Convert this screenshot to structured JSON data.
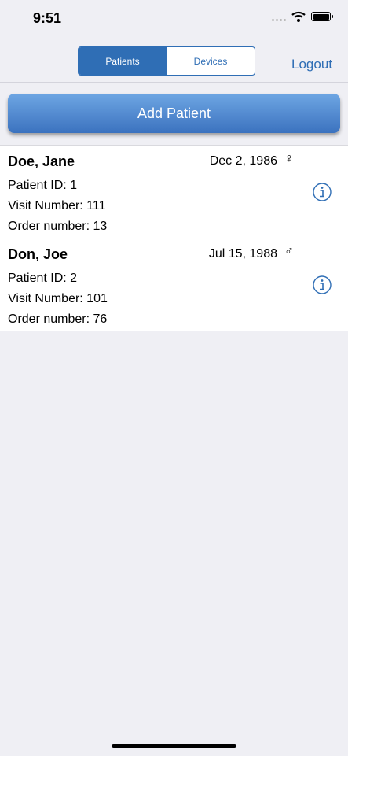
{
  "status_bar": {
    "time": "9:51"
  },
  "nav": {
    "segments": [
      "Patients",
      "Devices"
    ],
    "selected_segment": "Patients",
    "logout_label": "Logout"
  },
  "add_patient_label": "Add Patient",
  "patients": [
    {
      "name": "Doe, Jane",
      "dob": "Dec 2, 1986",
      "gender_symbol": "♀",
      "patient_id": "Patient ID: 1",
      "visit_number": "Visit Number: 111",
      "order_number": "Order number: 13"
    },
    {
      "name": "Don, Joe",
      "dob": "Jul 15, 1988",
      "gender_symbol": "♂",
      "patient_id": "Patient ID: 2",
      "visit_number": "Visit Number: 101",
      "order_number": "Order number: 76"
    }
  ],
  "colors": {
    "accent": "#2f6eb5",
    "background": "#efeff4"
  }
}
